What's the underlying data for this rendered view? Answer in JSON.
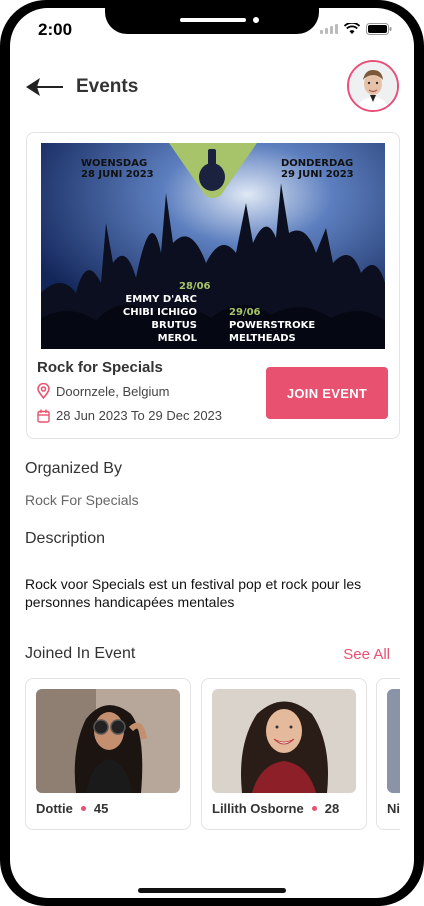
{
  "status_bar": {
    "time": "2:00"
  },
  "header": {
    "title": "Events"
  },
  "event": {
    "banner": {
      "left_day": "WOENSDAG",
      "left_date": "28 JUNI 2023",
      "right_day": "DONDERDAG",
      "right_date": "29 JUNI 2023",
      "col1_date": "28/06",
      "col1_acts": [
        "EMMY D'ARC",
        "CHIBI ICHIGO",
        "BRUTUS",
        "MEROL"
      ],
      "col2_date": "29/06",
      "col2_acts": [
        "POWERSTROKE",
        "MELTHEADS"
      ]
    },
    "name": "Rock for Specials",
    "location": "Doornzele, Belgium",
    "dates": "28 Jun 2023 To 29 Dec 2023",
    "join_label": "JOIN EVENT"
  },
  "organized": {
    "heading": "Organized By",
    "value": "Rock For Specials"
  },
  "description": {
    "heading": "Description",
    "text": "Rock voor Specials est un festival pop et rock pour les personnes handicapées mentales"
  },
  "joined": {
    "heading": "Joined In Event",
    "see_all": "See All",
    "people": [
      {
        "name": "Dottie",
        "age": "45"
      },
      {
        "name": "Lillith Osborne",
        "age": "28"
      },
      {
        "name": "Ni",
        "age": ""
      }
    ]
  },
  "colors": {
    "accent": "#e8516f",
    "banner_bg": "#1a3a7a",
    "banner_green": "#a8c46a"
  },
  "icons": [
    "back-arrow-icon",
    "location-pin-icon",
    "calendar-icon",
    "wifi-icon",
    "battery-icon",
    "signal-icon"
  ]
}
